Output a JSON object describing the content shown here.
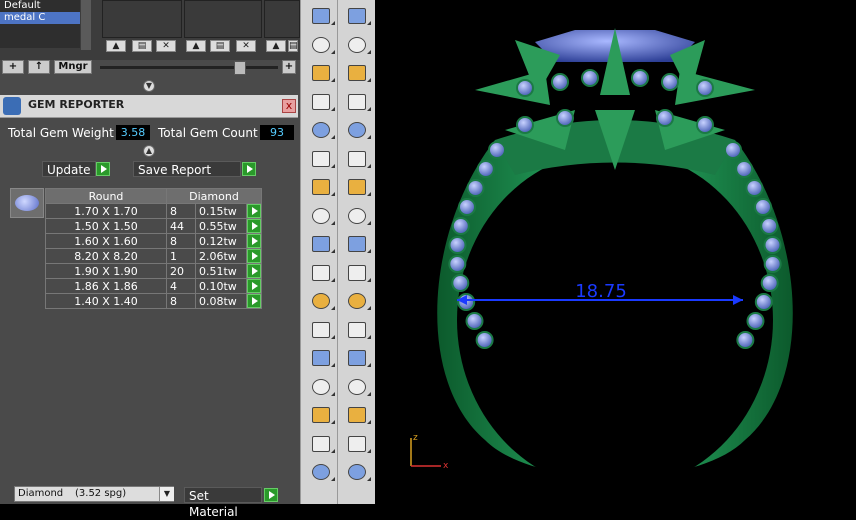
{
  "layers": {
    "items": [
      "Default",
      "medal C"
    ],
    "buttons": [
      "+",
      "↑",
      "Mngr"
    ]
  },
  "gem_reporter": {
    "title": "GEM REPORTER",
    "close": "x",
    "total_weight_label": "Total Gem Weight",
    "total_weight_value": "3.58",
    "total_count_label": "Total Gem Count",
    "total_count_value": "93",
    "update_label": "Update",
    "save_label": "Save Report",
    "table": {
      "shape": "Round",
      "material": "Diamond",
      "rows": [
        {
          "size": "1.70 X 1.70",
          "count": "8",
          "weight": "0.15tw"
        },
        {
          "size": "1.50 X 1.50",
          "count": "44",
          "weight": "0.55tw"
        },
        {
          "size": "1.60 X 1.60",
          "count": "8",
          "weight": "0.12tw"
        },
        {
          "size": "8.20 X 8.20",
          "count": "1",
          "weight": "2.06tw"
        },
        {
          "size": "1.90 X 1.90",
          "count": "20",
          "weight": "0.51tw"
        },
        {
          "size": "1.86 X 1.86",
          "count": "4",
          "weight": "0.10tw"
        },
        {
          "size": "1.40 X 1.40",
          "count": "8",
          "weight": "0.08tw"
        }
      ]
    }
  },
  "bottom": {
    "material_select": "Diamond",
    "material_spg": "(3.52 spg)",
    "set_material_label": "Set Material"
  },
  "viewport": {
    "dimension": "18.75",
    "axis_z": "z",
    "axis_x": "x"
  },
  "colors": {
    "ring_green": "#1f8a4c",
    "gem_blue": "#5a78c8",
    "dimension_blue": "#1a3aff",
    "accent_green": "#2a9a2a"
  }
}
